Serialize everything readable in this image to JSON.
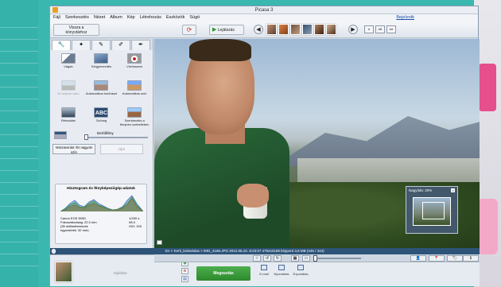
{
  "window": {
    "title": "Picasa 3"
  },
  "menu": [
    "Fájl",
    "Szerkesztés",
    "Nézet",
    "Album",
    "Kép",
    "Létrehozás",
    "Eszközök",
    "Súgó"
  ],
  "signin": "Bejelentk",
  "toolbar": {
    "back_line1": "Vissza a",
    "back_line2": "könyvtárhoz",
    "play_label": "Lejátszás",
    "view_buttons": [
      "A",
      "AB",
      "AA"
    ]
  },
  "left_panel": {
    "tabs": [
      "wrench-icon",
      "brush-icon",
      "pencil-icon",
      "edit-icon",
      "paint-icon"
    ],
    "tools": [
      {
        "label": "Vágás",
        "icon": "crop-icon",
        "enabled": true
      },
      {
        "label": "Kiegyenesítés",
        "icon": "straighten-icon",
        "enabled": true
      },
      {
        "label": "Vörösszem",
        "icon": "redeye-icon",
        "enabled": true
      },
      {
        "label": "Jó helyzet vaku",
        "icon": "auto-icon",
        "enabled": false
      },
      {
        "label": "Automatikus kontraszt",
        "icon": "contrast-icon",
        "enabled": true
      },
      {
        "label": "Automatikus szín",
        "icon": "color-icon",
        "enabled": true
      },
      {
        "label": "Retusálás",
        "icon": "retouch-icon",
        "enabled": true
      },
      {
        "label": "Szöveg",
        "icon": "text-icon",
        "enabled": true
      },
      {
        "label": "Szerkesztés a fényben szekelteben",
        "icon": "fill-icon",
        "enabled": true
      }
    ],
    "fill_label": "Derítőfény",
    "undo_line1": "Visszavonás: És nagyom",
    "undo_line2": "szín",
    "redo_label": "Újra"
  },
  "histogram": {
    "title": "Hisztogram és fényképezőgép-adatok",
    "info_left": [
      "Canon EOS 500D",
      "Fókusztávolság: 22.0 mm",
      "(35 milliméteresnek",
      "egyenérték: 32 mm)"
    ],
    "info_right": [
      "1/200 s",
      "f/8.0",
      "ISO: 100",
      ""
    ]
  },
  "navigator": {
    "zoom_label": "Nagyítás: 20%",
    "close": "x"
  },
  "statusbar": {
    "text": "En > Kerti_kirándulas > IMG_4166.JPG   2012.06.10. 8:23:07   4752x3168 képpont   3,8 MB   (445 / 444)"
  },
  "tray": {
    "label": "Kijelölve"
  },
  "share": {
    "label": "Megosztás"
  },
  "actions": [
    {
      "label": "E-mail",
      "icon": "email-icon"
    },
    {
      "label": "Nyomtatás",
      "icon": "print-icon"
    },
    {
      "label": "Exportálás",
      "icon": "export-icon"
    }
  ],
  "colors": {
    "accent": "#2d8a2d",
    "statusbar": "#2d5478",
    "magazine_bg": "#3ab8b0"
  }
}
